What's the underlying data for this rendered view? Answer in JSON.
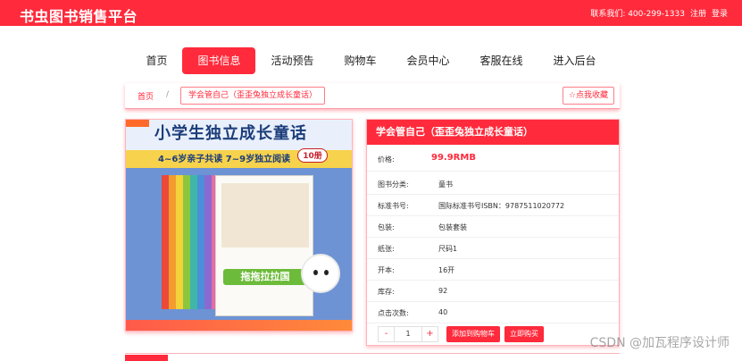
{
  "header": {
    "brand": "书虫图书销售平台",
    "contact": "联系我们: 400-299-1333",
    "register": "注册",
    "login": "登录"
  },
  "nav": {
    "items": [
      "首页",
      "图书信息",
      "活动预告",
      "购物车",
      "会员中心",
      "客服在线",
      "进入后台"
    ],
    "active_index": 1
  },
  "breadcrumb": {
    "home": "首页",
    "separator": "/",
    "current": "学会管自己（歪歪兔独立成长童话）",
    "favorite": "☆点我收藏"
  },
  "cover": {
    "title": "小学生独立成长童话",
    "subtitle": "4~6岁亲子共读  7~9岁独立阅读",
    "badge": "10册",
    "box_title": "拖拖拉拉国"
  },
  "product": {
    "title": "学会管自己（歪歪兔独立成长童话）",
    "rows": [
      {
        "label": "价格:",
        "value": "99.9RMB",
        "is_price": true
      },
      {
        "label": "图书分类:",
        "value": "童书"
      },
      {
        "label": "标准书号:",
        "value": "国际标准书号ISBN：9787511020772"
      },
      {
        "label": "包装:",
        "value": "包装套装"
      },
      {
        "label": "纸张:",
        "value": "尺码1"
      },
      {
        "label": "开本:",
        "value": "16开"
      },
      {
        "label": "库存:",
        "value": "92"
      },
      {
        "label": "点击次数:",
        "value": "40"
      }
    ],
    "quantity": "1",
    "minus": "-",
    "plus": "+",
    "add_to_cart": "添加到购物车",
    "buy_now": "立即购买"
  },
  "watermark": "CSDN @加瓦程序设计师",
  "colors": {
    "accent": "#ff2a3b"
  }
}
